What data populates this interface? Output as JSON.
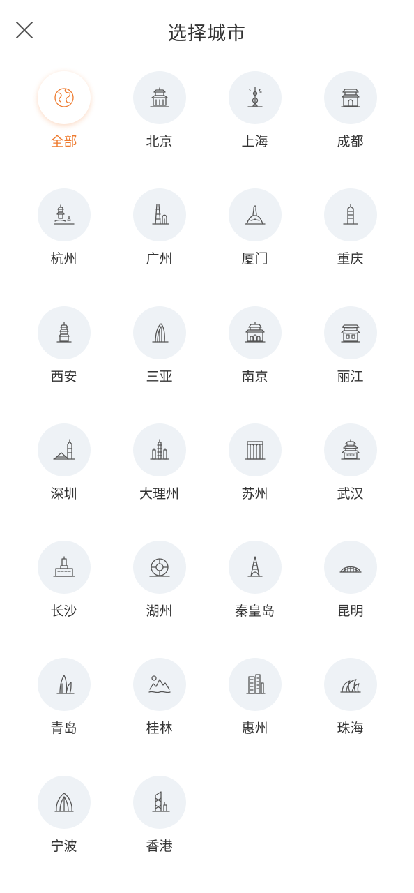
{
  "header": {
    "title": "选择城市",
    "close_icon": "close-icon"
  },
  "accent_color": "#ee7a2e",
  "cities": [
    {
      "name": "全部",
      "icon": "globe-icon",
      "selected": true
    },
    {
      "name": "北京",
      "icon": "temple-icon",
      "selected": false
    },
    {
      "name": "上海",
      "icon": "tv-tower-icon",
      "selected": false
    },
    {
      "name": "成都",
      "icon": "gate-tower-icon",
      "selected": false
    },
    {
      "name": "杭州",
      "icon": "pagoda-lake-icon",
      "selected": false
    },
    {
      "name": "广州",
      "icon": "canton-tower-icon",
      "selected": false
    },
    {
      "name": "厦门",
      "icon": "statue-rock-icon",
      "selected": false
    },
    {
      "name": "重庆",
      "icon": "tower-icon",
      "selected": false
    },
    {
      "name": "西安",
      "icon": "pagoda-icon",
      "selected": false
    },
    {
      "name": "三亚",
      "icon": "sail-building-icon",
      "selected": false
    },
    {
      "name": "南京",
      "icon": "city-gate-icon",
      "selected": false
    },
    {
      "name": "丽江",
      "icon": "ancient-house-icon",
      "selected": false
    },
    {
      "name": "深圳",
      "icon": "skyline-icon",
      "selected": false
    },
    {
      "name": "大理州",
      "icon": "three-pagodas-icon",
      "selected": false
    },
    {
      "name": "苏州",
      "icon": "gate-building-icon",
      "selected": false
    },
    {
      "name": "武汉",
      "icon": "yellow-crane-tower-icon",
      "selected": false
    },
    {
      "name": "长沙",
      "icon": "monument-icon",
      "selected": false
    },
    {
      "name": "湖州",
      "icon": "moon-hotel-icon",
      "selected": false
    },
    {
      "name": "秦皇岛",
      "icon": "spire-icon",
      "selected": false
    },
    {
      "name": "昆明",
      "icon": "arch-stadium-icon",
      "selected": false
    },
    {
      "name": "青岛",
      "icon": "sail-tower-icon",
      "selected": false
    },
    {
      "name": "桂林",
      "icon": "karst-mountain-icon",
      "selected": false
    },
    {
      "name": "惠州",
      "icon": "highrise-icon",
      "selected": false
    },
    {
      "name": "珠海",
      "icon": "opera-house-icon",
      "selected": false
    },
    {
      "name": "宁波",
      "icon": "shell-building-icon",
      "selected": false
    },
    {
      "name": "香港",
      "icon": "bank-tower-icon",
      "selected": false
    }
  ]
}
